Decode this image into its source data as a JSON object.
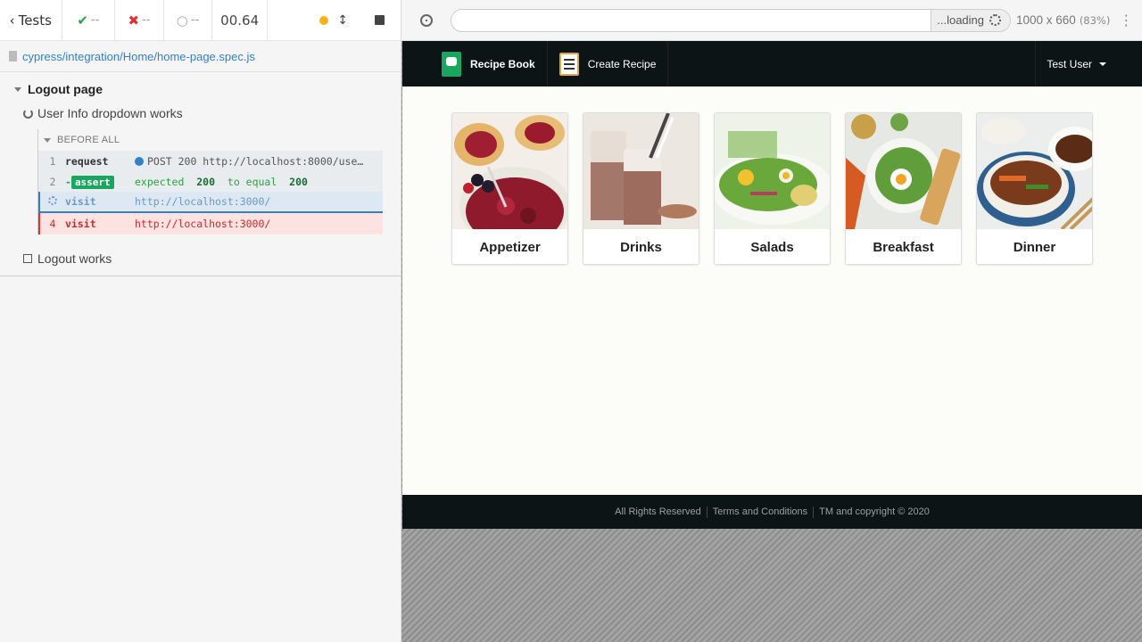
{
  "reporter": {
    "tests_label": "Tests",
    "passed": "--",
    "failed": "--",
    "pending": "--",
    "timer": "00.64",
    "file_path": "cypress/integration/Home/home-page.spec.js",
    "suite_title": "Logout page",
    "tests": [
      {
        "title": "User Info dropdown works",
        "state": "running"
      },
      {
        "title": "Logout works",
        "state": "pending"
      }
    ],
    "hook_label": "BEFORE ALL",
    "commands": [
      {
        "num": "1",
        "name": "request",
        "msg": "POST 200 http://localhost:8000/use…"
      },
      {
        "num": "2",
        "name": "assert",
        "prefix": "-",
        "msg_parts": [
          "expected",
          "200",
          "to equal",
          "200"
        ]
      },
      {
        "num": "",
        "name": "visit",
        "msg": "http://localhost:3000/",
        "state": "running"
      },
      {
        "num": "4",
        "name": "visit",
        "msg": "http://localhost:3000/",
        "state": "failed"
      }
    ]
  },
  "aut": {
    "url": "",
    "loading_label": "...loading",
    "viewport": "1000 x 660",
    "zoom": "(83%)",
    "menu": "⋮"
  },
  "app": {
    "brand": "Recipe Book",
    "create_recipe": "Create Recipe",
    "user": "Test User",
    "categories": [
      "Appetizer",
      "Drinks",
      "Salads",
      "Breakfast",
      "Dinner"
    ],
    "footer": [
      "All Rights Reserved",
      "Terms and Conditions",
      "TM and copyright © 2020"
    ]
  },
  "colors": {
    "pass": "#2f9e44",
    "fail": "#e03131",
    "link": "#3380c8",
    "navbar": "#0d1416"
  }
}
